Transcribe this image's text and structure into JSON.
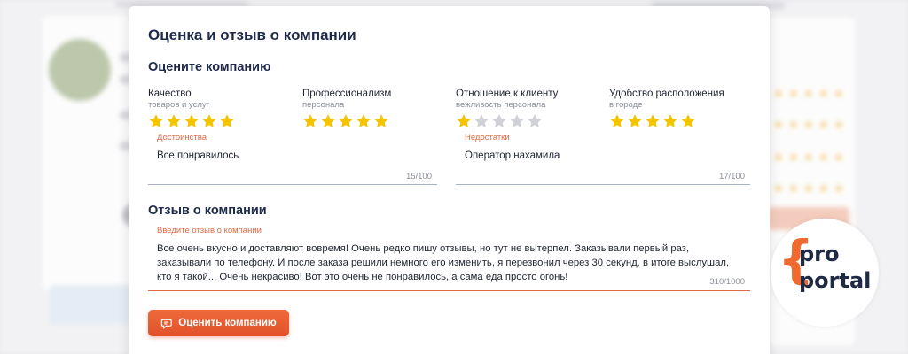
{
  "modal": {
    "title": "Оценка и отзыв о компании",
    "rate_heading": "Оцените компанию",
    "criteria": [
      {
        "label": "Качество",
        "sub": "товаров и услуг",
        "rating": 5
      },
      {
        "label": "Профессионализм",
        "sub": "персонала",
        "rating": 5
      },
      {
        "label": "Отношение к клиенту",
        "sub": "вежливость персонала",
        "rating": 1
      },
      {
        "label": "Удобство расположения",
        "sub": "в городе",
        "rating": 5
      }
    ],
    "pros": {
      "label": "Достоинства",
      "value": "Все понравилось",
      "counter": "15/100"
    },
    "cons": {
      "label": "Недостатки",
      "value": "Оператор нахамила",
      "counter": "17/100"
    },
    "review_heading": "Отзыв о компании",
    "review": {
      "label": "Введите отзыв о компании",
      "value": "Все очень вкусно и доставляют вовремя! Очень редко пишу отзывы, но тут не вытерпел. Заказывали первый раз, заказывали по телефону. И после заказа решили немного его изменить, я перезвонил через 30 секунд, в итоге выслушал, кто я такой... Очень некрасиво! Вот это очень не понравилось, а сама еда просто огонь!",
      "counter": "310/1000"
    },
    "submit_label": "Оценить компанию"
  },
  "logo": {
    "brace": "{",
    "line1": "pro",
    "line2": "portal"
  },
  "colors": {
    "star_on": "#f5c400",
    "star_off": "#cfd1d6",
    "accent": "#e2512a",
    "brand_dark": "#202a44"
  },
  "icons": {
    "submit": "review-chat-icon",
    "star": "star-icon"
  }
}
